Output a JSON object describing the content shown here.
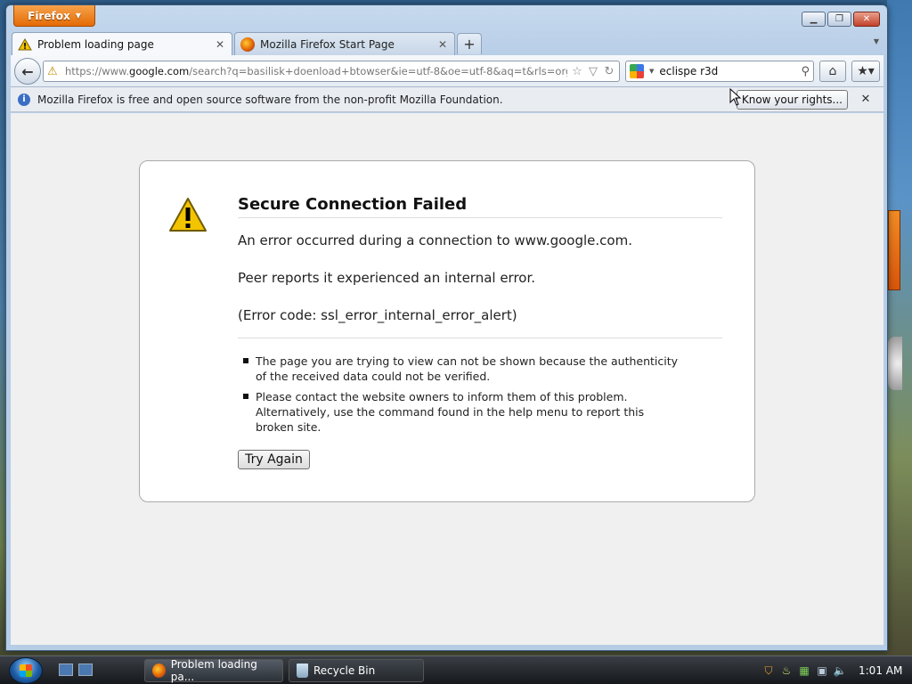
{
  "window": {
    "app_menu_label": "Firefox"
  },
  "tabs": [
    {
      "label": "Problem loading page"
    },
    {
      "label": "Mozilla Firefox Start Page"
    }
  ],
  "nav": {
    "url_prefix": "https://www.",
    "url_domain": "google.com",
    "url_rest": "/search?q=basilisk+doenload+btowser&ie=utf-8&oe=utf-8&aq=t&rls=org.m",
    "search_value": "eclispe r3d"
  },
  "notification": {
    "text": "Mozilla Firefox is free and open source software from the non-profit Mozilla Foundation.",
    "button_label": "Know your rights..."
  },
  "error": {
    "title": "Secure Connection Failed",
    "line1": "An error occurred during a connection to www.google.com.",
    "line2": "Peer reports it experienced an internal error.",
    "line3": "(Error code: ssl_error_internal_error_alert)",
    "bullets": [
      "The page you are trying to view can not be shown because the authenticity of the received data could not be verified.",
      "Please contact the website owners to inform them of this problem. Alternatively, use the command found in the help menu to report this broken site."
    ],
    "try_again_label": "Try Again"
  },
  "taskbar": {
    "items": [
      {
        "label": "Problem loading pa..."
      },
      {
        "label": "Recycle Bin"
      }
    ],
    "clock": "1:01 AM"
  },
  "colors": {
    "app_button": "#e46b06",
    "warning_yellow": "#f3c400",
    "info_blue": "#3a6fc4"
  }
}
